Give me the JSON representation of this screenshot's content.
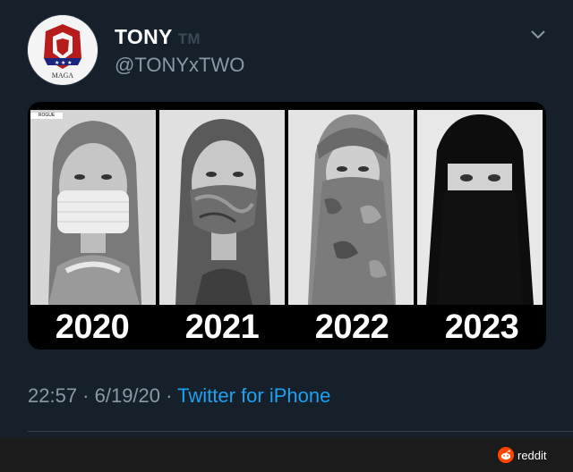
{
  "tweet": {
    "display_name": "TONY",
    "badge": "TM",
    "handle": "@TONYxTWO",
    "avatar_text": "MAGA",
    "timestamp": "22:57 · 6/19/20 ·",
    "source": "Twitter for iPhone"
  },
  "media": {
    "watermark": "ROGUE",
    "panels": [
      {
        "year": "2020"
      },
      {
        "year": "2021"
      },
      {
        "year": "2022"
      },
      {
        "year": "2023"
      }
    ]
  },
  "footer": {
    "reddit_label": "reddit"
  },
  "colors": {
    "background": "#15202b",
    "handle": "#8b98a5",
    "link": "#1da1f2",
    "reddit_orange": "#ff4500"
  }
}
